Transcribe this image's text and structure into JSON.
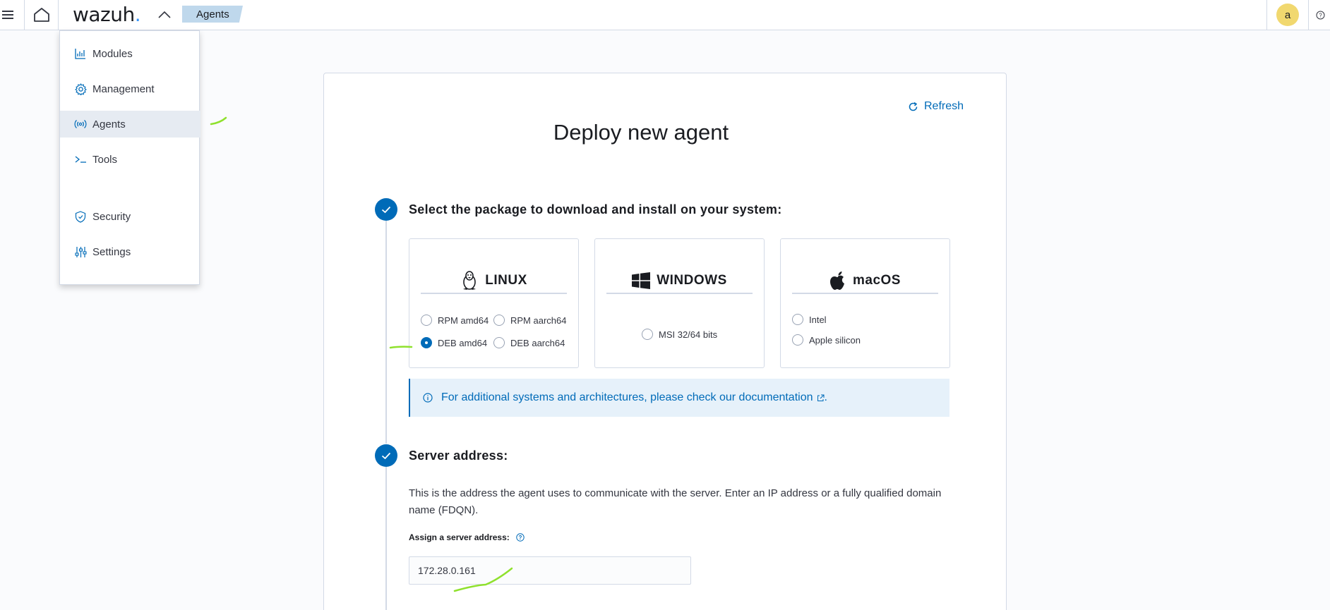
{
  "header": {
    "logo_text": "wazuh",
    "logo_dot": ".",
    "breadcrumb": "Agents",
    "avatar_letter": "a",
    "icons": [
      "menu-icon",
      "home-icon",
      "chevron-up-icon",
      "help-icon"
    ]
  },
  "menu": {
    "items": [
      {
        "label": "Modules",
        "icon": "chart-icon"
      },
      {
        "label": "Management",
        "icon": "gear-icon"
      },
      {
        "label": "Agents",
        "icon": "broadcast-icon",
        "active": true
      },
      {
        "label": "Tools",
        "icon": "console-icon"
      },
      {
        "label": "Security",
        "icon": "shield-icon"
      },
      {
        "label": "Settings",
        "icon": "sliders-icon"
      }
    ]
  },
  "main": {
    "refresh_label": "Refresh",
    "title": "Deploy new agent",
    "step1_title": "Select the package to download and install on your system:",
    "os": {
      "linux": {
        "label": "LINUX",
        "options": [
          "RPM amd64",
          "RPM aarch64",
          "DEB amd64",
          "DEB aarch64"
        ],
        "selected": "DEB amd64"
      },
      "windows": {
        "label": "WINDOWS",
        "options": [
          "MSI 32/64 bits"
        ]
      },
      "macos": {
        "label": "macOS",
        "options": [
          "Intel",
          "Apple silicon"
        ]
      }
    },
    "callout_text": "For additional systems and architectures, please check our documentation",
    "callout_end": ".",
    "step2_title": "Server address:",
    "step2_description": "This is the address the agent uses to communicate with the server. Enter an IP address or a fully qualified domain name (FDQN).",
    "server_label": "Assign a server address:",
    "server_value": "172.28.0.161"
  },
  "colors": {
    "accent": "#006bb8",
    "breadcrumb_bg": "#bfd8ec",
    "avatar_bg": "#f1d86f",
    "annotation": "#8fe12d"
  }
}
